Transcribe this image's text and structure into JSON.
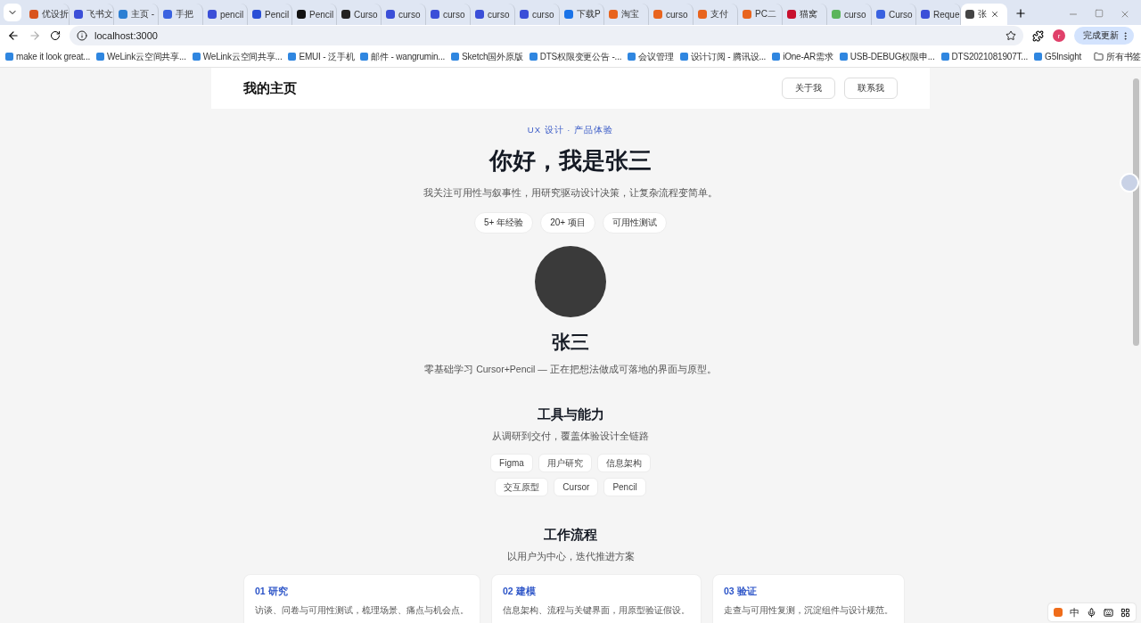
{
  "browser": {
    "tabs": [
      {
        "title": "优设折",
        "selected": false,
        "color": "#d9541e"
      },
      {
        "title": "飞书文",
        "selected": false,
        "color": "#3b4fd8"
      },
      {
        "title": "主页 -",
        "selected": false,
        "color": "#2d7fd3"
      },
      {
        "title": "手把",
        "selected": false,
        "color": "#3a62e0"
      },
      {
        "title": "pencil",
        "selected": false,
        "color": "#3b4fd8"
      },
      {
        "title": "Pencil",
        "selected": false,
        "color": "#2a4fd6"
      },
      {
        "title": "Pencil",
        "selected": false,
        "color": "#111111"
      },
      {
        "title": "Curso",
        "selected": false,
        "color": "#222222"
      },
      {
        "title": "curso",
        "selected": false,
        "color": "#3b4fd8"
      },
      {
        "title": "curso",
        "selected": false,
        "color": "#3b4fd8"
      },
      {
        "title": "curso",
        "selected": false,
        "color": "#3b4fd8"
      },
      {
        "title": "curso",
        "selected": false,
        "color": "#3b4fd8"
      },
      {
        "title": "下载P",
        "selected": false,
        "color": "#1a73e8"
      },
      {
        "title": "淘宝",
        "selected": false,
        "color": "#e8641e"
      },
      {
        "title": "curso",
        "selected": false,
        "color": "#e8641e"
      },
      {
        "title": "支付",
        "selected": false,
        "color": "#e8641e"
      },
      {
        "title": "PC二",
        "selected": false,
        "color": "#e8641e"
      },
      {
        "title": "猫窝",
        "selected": false,
        "color": "#c8102e"
      },
      {
        "title": "curso",
        "selected": false,
        "color": "#5bb55b"
      },
      {
        "title": "Curso",
        "selected": false,
        "color": "#3a62e0"
      },
      {
        "title": "Reque",
        "selected": false,
        "color": "#3b4fd8"
      },
      {
        "title": "张",
        "selected": true,
        "color": "#444444"
      }
    ],
    "address": "localhost:3000",
    "profile_initial": "r",
    "update_button": "完成更新",
    "bookmarks": [
      "make it look great...",
      "WeLink云空间共享...",
      "WeLink云空间共享...",
      "EMUI - 泛手机",
      "邮件 - wangrumin...",
      "Sketch国外原版",
      "DTS权限变更公告 -...",
      "会议管理",
      "设计订阅 - 腾讯设...",
      "iOne-AR需求",
      "USB-DEBUG权限申...",
      "DTS2021081907T...",
      "G5Insight"
    ],
    "all_bookmarks": "所有书签"
  },
  "page": {
    "header": {
      "title": "我的主页",
      "buttons": [
        "关于我",
        "联系我"
      ]
    },
    "hero": {
      "eyebrow": "UX 设计 · 产品体验",
      "title": "你好，我是张三",
      "subtitle": "我关注可用性与叙事性，用研究驱动设计决策，让复杂流程变简单。",
      "chips": [
        "5+ 年经验",
        "20+ 项目",
        "可用性测试"
      ]
    },
    "profile": {
      "name": "张三",
      "bio": "零基础学习 Cursor+Pencil — 正在把想法做成可落地的界面与原型。"
    },
    "skills": {
      "title": "工具与能力",
      "subtitle": "从调研到交付，覆盖体验设计全链路",
      "tags": [
        "Figma",
        "用户研究",
        "信息架构",
        "交互原型",
        "Cursor",
        "Pencil"
      ]
    },
    "process": {
      "title": "工作流程",
      "subtitle": "以用户为中心，迭代推进方案",
      "steps": [
        {
          "title": "01 研究",
          "text": "访谈、问卷与可用性测试，梳理场景、痛点与机会点。"
        },
        {
          "title": "02 建模",
          "text": "信息架构、流程与关键界面，用原型验证假设。"
        },
        {
          "title": "03 验证",
          "text": "走查与可用性复测，沉淀组件与设计规范。"
        }
      ]
    }
  },
  "ime_toolbar": {
    "label": "中"
  }
}
